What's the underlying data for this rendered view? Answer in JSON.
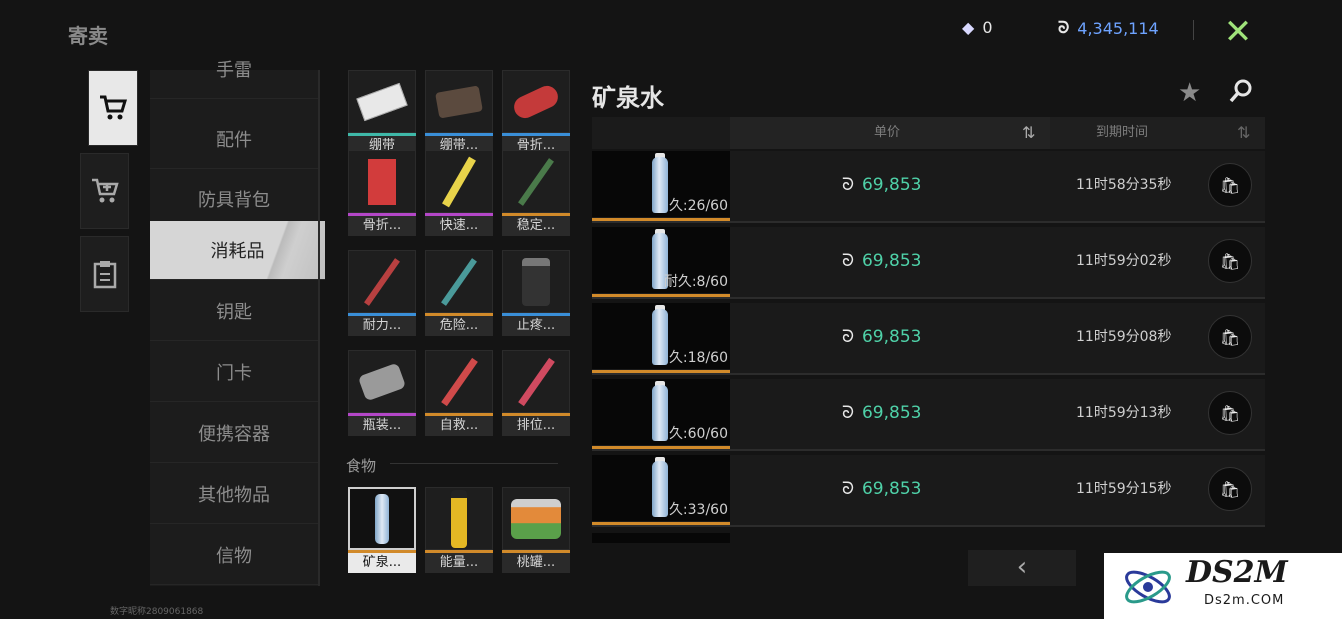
{
  "header": {
    "title": "寄卖",
    "gems": "0",
    "coins": "4,345,114"
  },
  "vtabs": [
    {
      "name": "market-tab",
      "icon": "cart-icon",
      "active": true
    },
    {
      "name": "sell-tab",
      "icon": "cart-plus-icon",
      "active": false
    },
    {
      "name": "record-tab",
      "icon": "clipboard-icon",
      "active": false
    }
  ],
  "categories": [
    "手雷",
    "配件",
    "防具背包",
    "消耗品",
    "钥匙",
    "门卡",
    "便携容器",
    "其他物品",
    "信物"
  ],
  "active_category": "消耗品",
  "items": [
    {
      "label": "绷带",
      "bar": "#3fb8a8"
    },
    {
      "label": "绷带...",
      "bar": "#3a8fd8"
    },
    {
      "label": "骨折...",
      "bar": "#3a8fd8"
    },
    {
      "label": "骨折...",
      "bar": "#b447c8"
    },
    {
      "label": "快速...",
      "bar": "#b447c8"
    },
    {
      "label": "稳定...",
      "bar": "#d18a2a"
    },
    {
      "label": "耐力...",
      "bar": "#3a8fd8"
    },
    {
      "label": "危险...",
      "bar": "#d18a2a"
    },
    {
      "label": "止疼...",
      "bar": "#3a8fd8"
    },
    {
      "label": "瓶装...",
      "bar": "#b447c8"
    },
    {
      "label": "自救...",
      "bar": "#d18a2a"
    },
    {
      "label": "排位...",
      "bar": "#d18a2a"
    }
  ],
  "food_header": "食物",
  "food_items": [
    {
      "label": "矿泉...",
      "bar": "#d18a2a",
      "selected": true
    },
    {
      "label": "能量...",
      "bar": "#d18a2a",
      "selected": false
    },
    {
      "label": "桃罐...",
      "bar": "#d18a2a",
      "selected": false
    }
  ],
  "detail": {
    "item_name": "矿泉水",
    "col_price": "单价",
    "col_expire": "到期时间",
    "rows": [
      {
        "durability": "久:26/60",
        "price": "69,853",
        "time": "11时58分35秒"
      },
      {
        "durability": "耐久:8/60",
        "price": "69,853",
        "time": "11时59分02秒"
      },
      {
        "durability": "久:18/60",
        "price": "69,853",
        "time": "11时59分08秒"
      },
      {
        "durability": "久:60/60",
        "price": "69,853",
        "time": "11时59分13秒"
      },
      {
        "durability": "久:33/60",
        "price": "69,853",
        "time": "11时59分15秒"
      }
    ]
  },
  "footer_text": "数字昵称2809061868",
  "watermark": {
    "brand": "DS2M",
    "url": "Ds2m.COM"
  }
}
